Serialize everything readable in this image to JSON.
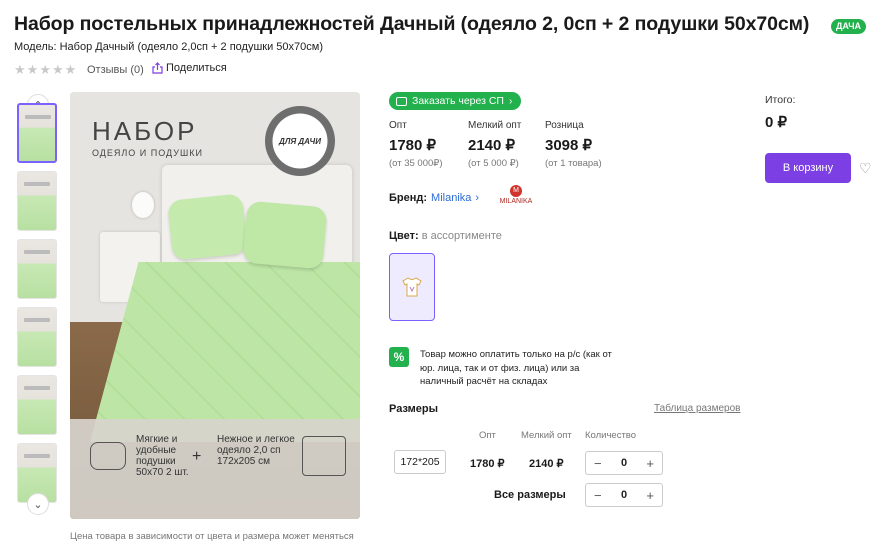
{
  "product": {
    "title": "Набор постельных принадлежностей Дачный (одеяло 2, 0сп + 2 подушки 50x70см)",
    "tag": "ДАЧА",
    "model": "Модель: Набор Дачный (одеяло 2,0сп + 2 подушки 50x70см)",
    "rating_stars": 0,
    "reviews": "Отзывы (0)",
    "share": "Поделиться"
  },
  "image": {
    "headline": "НАБОР",
    "subheadline": "ОДЕЯЛО И ПОДУШКИ",
    "seal": "ДЛЯ ДАЧИ",
    "pillows_text": "Мягкие и удобные подушки 50х70 2 шт.",
    "blanket_text": "Нежное и легкое одеяло 2,0 сп 172х205 см",
    "caption": "Цена товара в зависимости от цвета и размера может меняться"
  },
  "order_button": "Заказать через СП",
  "prices": [
    {
      "label": "Опт",
      "value": "1780 ₽",
      "note": "(от 35 000₽)"
    },
    {
      "label": "Мелкий опт",
      "value": "2140 ₽",
      "note": "(от 5 000 ₽)"
    },
    {
      "label": "Розница",
      "value": "3098 ₽",
      "note": "(от 1 товара)"
    }
  ],
  "total": {
    "label": "Итого:",
    "value": "0 ₽"
  },
  "cart_button": "В корзину",
  "brand": {
    "label": "Бренд:",
    "name": "Milanika",
    "logo_text": "MILANIKA"
  },
  "color": {
    "label": "Цвет:",
    "value": "в ассортименте"
  },
  "payment_note": "Товар можно оплатить только на р/с (как от юр. лица, так и от физ. лица) или за наличный расчёт на складах",
  "sizes": {
    "heading": "Размеры",
    "table_link": "Таблица размеров",
    "col_opt": "Опт",
    "col_small": "Мелкий опт",
    "col_qty": "Количество",
    "rows": [
      {
        "size": "172*205",
        "opt": "1780 ₽",
        "small": "2140 ₽",
        "qty": "0"
      }
    ],
    "all_label": "Все размеры",
    "all_qty": "0"
  },
  "colors": {
    "accent": "#7b3fe4",
    "green": "#22b14c"
  }
}
